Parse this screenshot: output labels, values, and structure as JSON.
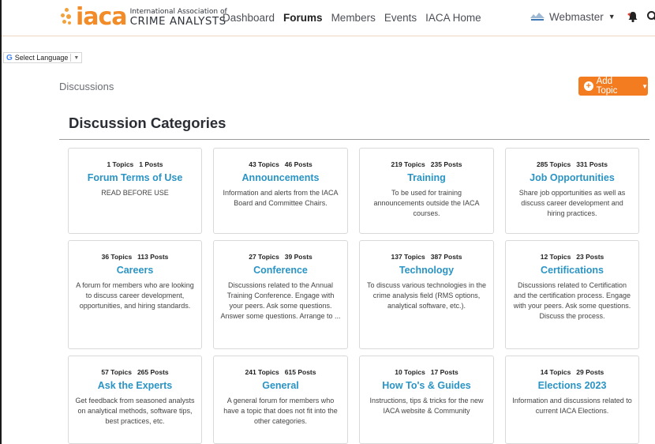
{
  "header": {
    "logo_mark": "iaca",
    "logo_line1": "International Association of",
    "logo_line2": "CRIME ANALYSTS",
    "nav": [
      {
        "label": "Dashboard",
        "active": false
      },
      {
        "label": "Forums",
        "active": true
      },
      {
        "label": "Members",
        "active": false
      },
      {
        "label": "Events",
        "active": false
      },
      {
        "label": "IACA Home",
        "active": false
      }
    ],
    "user_name": "Webmaster"
  },
  "translate": {
    "label": "Select Language",
    "arrow": "▼"
  },
  "breadcrumb": "Discussions",
  "add_topic": {
    "label": "Add Topic"
  },
  "section_title": "Discussion Categories",
  "colors": {
    "accent": "#f47c20",
    "link": "#2a94c4"
  },
  "categories": [
    {
      "topics": "1 Topics",
      "posts": "1 Posts",
      "title": "Forum Terms of Use",
      "desc": "READ BEFORE USE"
    },
    {
      "topics": "43 Topics",
      "posts": "46 Posts",
      "title": "Announcements",
      "desc": "Information and alerts from the IACA Board and Committee Chairs."
    },
    {
      "topics": "219 Topics",
      "posts": "235 Posts",
      "title": "Training",
      "desc": "To be used for training announcements outside the IACA courses."
    },
    {
      "topics": "285 Topics",
      "posts": "331 Posts",
      "title": "Job Opportunities",
      "desc": "Share job opportunities as well as discuss career development and hiring practices."
    },
    {
      "topics": "36 Topics",
      "posts": "113 Posts",
      "title": "Careers",
      "desc": "A forum for members who are looking to discuss career development, opportunities, and hiring standards."
    },
    {
      "topics": "27 Topics",
      "posts": "39 Posts",
      "title": "Conference",
      "desc": "Discussions related to the Annual Training Conference. Engage with your peers. Ask some questions. Answer some questions. Arrange to ..."
    },
    {
      "topics": "137 Topics",
      "posts": "387 Posts",
      "title": "Technology",
      "desc": "To discuss various technologies in the crime analysis field (RMS options, analytical software, etc.)."
    },
    {
      "topics": "12 Topics",
      "posts": "23 Posts",
      "title": "Certifications",
      "desc": "Discussions related to Certification and the certification process. Engage with your peers. Ask some questions. Discuss the process."
    },
    {
      "topics": "57 Topics",
      "posts": "265 Posts",
      "title": "Ask the Experts",
      "desc": "Get feedback from seasoned analysts on analytical methods, software tips, best practices, etc."
    },
    {
      "topics": "241 Topics",
      "posts": "615 Posts",
      "title": "General",
      "desc": "A general forum for members who have a topic that does not fit into the other categories."
    },
    {
      "topics": "10 Topics",
      "posts": "17 Posts",
      "title": "How To's & Guides",
      "desc": "Instructions, tips & tricks for the new IACA website & Community"
    },
    {
      "topics": "14 Topics",
      "posts": "29 Posts",
      "title": "Elections 2023",
      "desc": "Information and discussions related to current IACA Elections."
    }
  ]
}
